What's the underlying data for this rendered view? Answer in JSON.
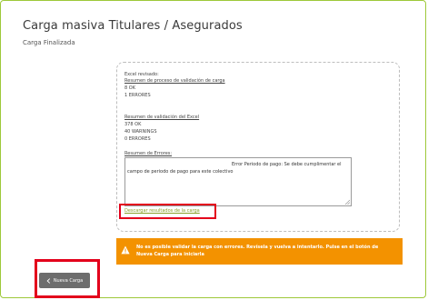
{
  "header": {
    "title": "Carga masiva Titulares / Asegurados",
    "subtitle": "Carga Finalizada"
  },
  "panel": {
    "file_heading": "Excel revisado:",
    "validation_process_title": "Resumen de proceso de validación de carga",
    "process_ok": "8 OK",
    "process_errors": "1 ERRORES",
    "excel_validation_title": "Resumen de validación del Excel",
    "excel_ok": "378 OK",
    "excel_warnings": "40 WARNINGS",
    "excel_errors": "0 ERRORES",
    "errors_summary_label": "Resumen de Errores:",
    "errors_text_line1": "Error Periodo de pago: Se debe cumplimentar el",
    "errors_text_line2": "campo de periodo de pago para este colectivo",
    "download_link": "Descargar resultados de la carga"
  },
  "warning": {
    "icon": "warning-triangle-icon",
    "text": "No es posible validar la carga con errores. Revísela y vuelva a intentarlo. Pulse en el botón de Nueva Carga para iniciarla"
  },
  "actions": {
    "new_upload_icon": "chevron-left-icon",
    "new_upload_label": "Nueva Carga"
  },
  "colors": {
    "frame_border": "#9ec93a",
    "warning_bg": "#f39200",
    "highlight": "#e3001b",
    "link": "#8aa12a",
    "button_bg": "#6d6d6d"
  }
}
